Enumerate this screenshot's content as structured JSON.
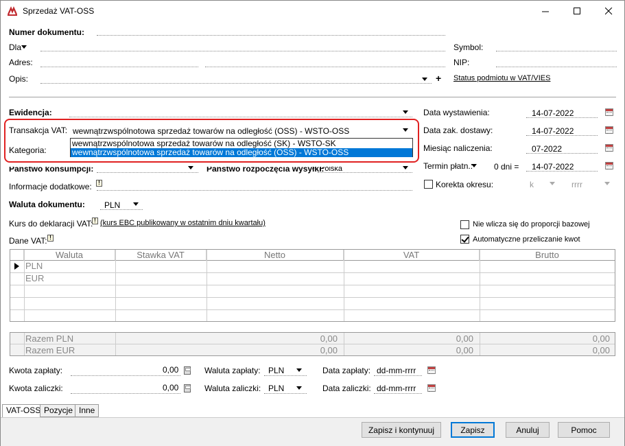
{
  "window": {
    "title": "Sprzedaż VAT-OSS"
  },
  "header": {
    "numer_label": "Numer dokumentu:",
    "dla_label": "Dla",
    "adres_label": "Adres:",
    "opis_label": "Opis:",
    "symbol_label": "Symbol:",
    "nip_label": "NIP:",
    "plus": "+",
    "status_link": "Status podmiotu w VAT/VIES"
  },
  "ewidencja": {
    "label": "Ewidencja:"
  },
  "transakcja": {
    "label": "Transakcja VAT:",
    "value": "wewnątrzwspólnotowa sprzedaż towarów na odległość (OSS) - WSTO-OSS",
    "options": [
      "wewnątrzwspólnotowa sprzedaż towarów na odległość (SK) - WSTO-SK",
      "wewnątrzwspólnotowa sprzedaż towarów na odległość (OSS) - WSTO-OSS"
    ]
  },
  "kategoria": {
    "label": "Kategoria:"
  },
  "panstwo": {
    "konsumpcji_label": "Państwo konsumpcji:",
    "rozpoczecia_label": "Państwo rozpoczęcia wysyłki:",
    "rozpoczecia_value": "Polska"
  },
  "info_dodatkowe": {
    "label": "Informacje dodatkowe:"
  },
  "waluta": {
    "label": "Waluta dokumentu:",
    "value": "PLN"
  },
  "kurs": {
    "label": "Kurs do deklaracji VAT:",
    "link": "(kurs EBC publikowany w ostatnim dniu kwartału)"
  },
  "dane_vat": {
    "label": "Dane VAT:"
  },
  "dates": {
    "wystawienia_label": "Data wystawienia:",
    "wystawienia_value": "14-07-2022",
    "dostawy_label": "Data zak. dostawy:",
    "dostawy_value": "14-07-2022",
    "naliczenia_label": "Miesiąc naliczenia:",
    "naliczenia_value": "07-2022",
    "termin_label": "Termin płatn.:",
    "termin_days": "0 dni =",
    "termin_value": "14-07-2022"
  },
  "korekta": {
    "label": "Korekta okresu:",
    "k": "k",
    "rrrr": "rrrr"
  },
  "options": {
    "nie_wlicza": "Nie wlicza się do proporcji bazowej",
    "auto_przeliczanie": "Automatyczne przeliczanie kwot"
  },
  "grid": {
    "columns": [
      "Waluta",
      "Stawka VAT",
      "Netto",
      "VAT",
      "Brutto"
    ],
    "rows": [
      "PLN",
      "EUR"
    ]
  },
  "totals": {
    "rows": [
      {
        "label": "Razem PLN",
        "netto": "0,00",
        "vat": "0,00",
        "brutto": "0,00"
      },
      {
        "label": "Razem EUR",
        "netto": "0,00",
        "vat": "0,00",
        "brutto": "0,00"
      }
    ]
  },
  "payment": {
    "kwota_zaplaty_label": "Kwota zapłaty:",
    "kwota_zaplaty_value": "0,00",
    "kwota_zaliczki_label": "Kwota zaliczki:",
    "kwota_zaliczki_value": "0,00",
    "waluta_zaplaty_label": "Waluta zapłaty:",
    "waluta_zaplaty_value": "PLN",
    "waluta_zaliczki_label": "Waluta zaliczki:",
    "waluta_zaliczki_value": "PLN",
    "data_zaplaty_label": "Data zapłaty:",
    "data_zaplaty_value": "dd-mm-rrrr",
    "data_zaliczki_label": "Data zaliczki:",
    "data_zaliczki_value": "dd-mm-rrrr"
  },
  "tabs": [
    "VAT-OSS",
    "Pozycje",
    "Inne"
  ],
  "buttons": {
    "zapisz_kontynuuj": "Zapisz i kontynuuj",
    "zapisz": "Zapisz",
    "anuluj": "Anuluj",
    "pomoc": "Pomoc"
  },
  "colors": {
    "accent": "#0078d7",
    "highlight_box": "#e02020"
  }
}
